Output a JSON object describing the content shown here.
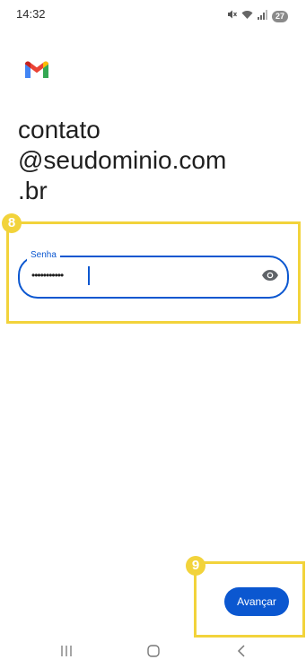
{
  "status_bar": {
    "time": "14:32",
    "battery": "27",
    "icons": [
      "mute-icon",
      "wifi-icon",
      "signal-icon",
      "battery-icon"
    ]
  },
  "app": {
    "logo": "gmail-logo"
  },
  "account": {
    "email_lines": [
      "contato",
      "@seudominio.com",
      ".br"
    ]
  },
  "password": {
    "label": "Senha",
    "value_masked": "•••••••••••",
    "toggle_icon": "eye-icon"
  },
  "actions": {
    "next_label": "Avançar"
  },
  "callouts": {
    "step_8": "8",
    "step_9": "9",
    "color": "#f2d33b"
  },
  "colors": {
    "accent": "#0b57d0",
    "callout": "#f2d33b"
  },
  "nav": {
    "icons": [
      "recent-apps-icon",
      "home-icon",
      "back-icon"
    ]
  }
}
